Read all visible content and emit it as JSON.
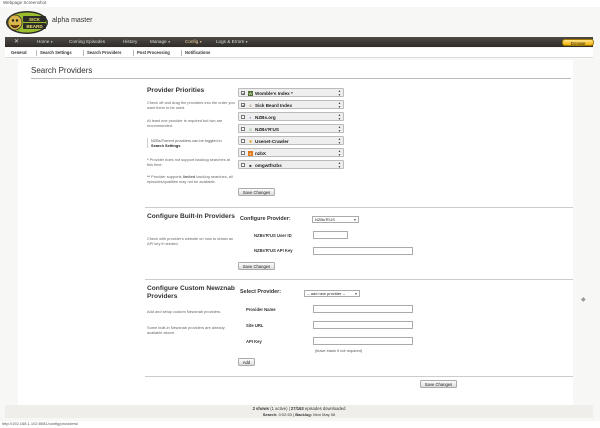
{
  "browser": {
    "window_title": "Webpage Screenshot"
  },
  "header": {
    "app_title": "alpha master",
    "logo_text": "SICK BEARD"
  },
  "navbar": {
    "items": [
      {
        "label": "Home",
        "has_menu": true
      },
      {
        "label": "Coming Episodes",
        "has_menu": false
      },
      {
        "label": "History",
        "has_menu": false
      },
      {
        "label": "Manage",
        "has_menu": true
      },
      {
        "label": "Config",
        "has_menu": true,
        "active": true
      },
      {
        "label": "Logs & Errors",
        "has_menu": true
      }
    ],
    "donate_label": "Donate",
    "tools_icon": "tools-icon"
  },
  "subnav": {
    "items": [
      "General",
      "Search Settings",
      "Search Providers",
      "Post Processing",
      "Notifications"
    ]
  },
  "page": {
    "title": "Search Providers"
  },
  "priorities": {
    "title": "Provider Priorities",
    "desc1": "Check off and drag the providers into the order you want them to be used.",
    "desc2": "At least one provider is required but two are recommended.",
    "note_text": "NZBs/Torrent providers can be toggled in",
    "note_link": "Search Settings",
    "legend1_marker": "*",
    "legend1_text": "Provider does not support backlog searches at this time.",
    "legend2_marker": "**",
    "legend2_text_pre": "Provider supports",
    "legend2_bold": "limited",
    "legend2_text_post": "backlog searches, all episodes/qualities may not be available.",
    "providers": [
      {
        "name": "Womble's Index *",
        "checked": true,
        "icon": "womble-icon",
        "glyph": "W"
      },
      {
        "name": "Sick Beard Index",
        "checked": true,
        "icon": "sickbeard-icon",
        "glyph": "☺"
      },
      {
        "name": "NZBs.org",
        "checked": false,
        "icon": "nzbsorg-icon",
        "glyph": "▪"
      },
      {
        "name": "NZBs'R'US",
        "checked": false,
        "icon": "nzbsrus-icon",
        "glyph": "☺"
      },
      {
        "name": "Usenet-Crawler",
        "checked": false,
        "icon": "usenet-crawler-icon",
        "glyph": "✹"
      },
      {
        "name": "nzbX",
        "checked": false,
        "icon": "nzbx-icon",
        "glyph": "x"
      },
      {
        "name": "omgwtfnzbs",
        "checked": false,
        "icon": "omgwtf-icon",
        "glyph": "■"
      }
    ],
    "save_label": "Save Changes"
  },
  "builtin": {
    "title": "Configure Built-In Providers",
    "desc": "Check with provider's website on how to obtain an API key if needed.",
    "configure_label": "Configure Provider:",
    "selected_provider": "NZBs'R'US",
    "user_id_label": "NZBs'R'US User ID",
    "user_id_value": "",
    "api_key_label": "NZBs'R'US API Key",
    "api_key_value": "",
    "save_label": "Save Changes"
  },
  "custom": {
    "title": "Configure Custom Newznab Providers",
    "desc1": "Add and setup custom Newznab providers.",
    "desc2": "Some built-in Newznab providers are already available above.",
    "select_label": "Select Provider:",
    "selected_provider": "-- add new provider --",
    "name_label": "Provider Name",
    "name_value": "",
    "url_label": "Site URL",
    "url_value": "",
    "api_key_label": "API Key",
    "api_key_value": "",
    "api_key_hint": "(leave blank if not required)",
    "add_label": "Add"
  },
  "bottom_save_label": "Save Changes",
  "footer": {
    "shows_count": "2 shows",
    "active": "(1 active)",
    "episodes": "27/163",
    "episodes_suffix": "episodes downloaded",
    "search_label": "Search:",
    "search_value": "0:02:53",
    "backlog_label": "Backlog:",
    "backlog_value": "Mon May 06"
  },
  "status_url": "http://192.168.1.102:8081/config/providers/"
}
